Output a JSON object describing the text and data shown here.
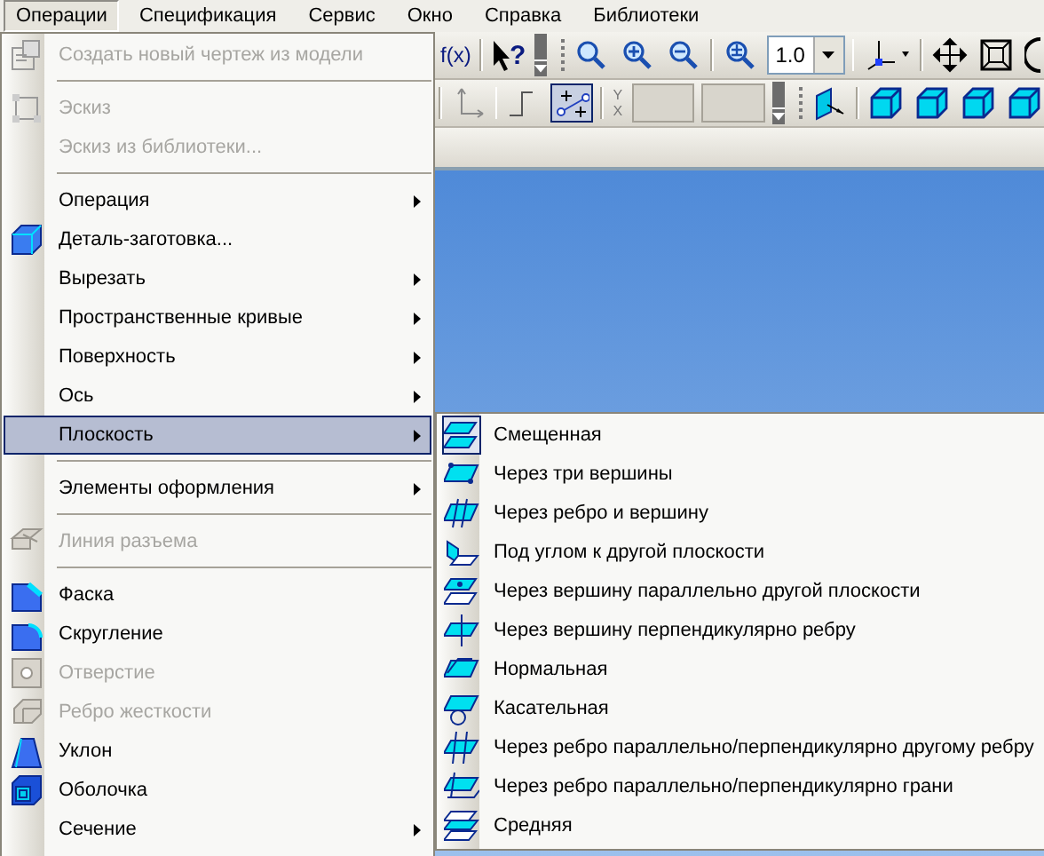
{
  "menubar": [
    {
      "label": "Операции",
      "selected": true
    },
    {
      "label": "Спецификация",
      "selected": false
    },
    {
      "label": "Сервис",
      "selected": false
    },
    {
      "label": "Окно",
      "selected": false
    },
    {
      "label": "Справка",
      "selected": false
    },
    {
      "label": "Библиотеки",
      "selected": false
    }
  ],
  "toolbar_rows": [
    [
      {
        "kind": "text",
        "label": "f(x)"
      },
      {
        "kind": "separator"
      },
      {
        "kind": "help",
        "label": "?"
      },
      {
        "kind": "chevron"
      },
      {
        "kind": "grip"
      },
      {
        "kind": "zoom-window"
      },
      {
        "kind": "zoom-in"
      },
      {
        "kind": "zoom-out"
      },
      {
        "kind": "separator"
      },
      {
        "kind": "zoom-scale"
      },
      {
        "kind": "combo",
        "value": "1.0"
      },
      {
        "kind": "separator"
      },
      {
        "kind": "axes"
      },
      {
        "kind": "separator"
      },
      {
        "kind": "pan"
      },
      {
        "kind": "frame"
      },
      {
        "kind": "rotate"
      }
    ],
    [
      {
        "kind": "separator"
      },
      {
        "kind": "axis-disabled"
      },
      {
        "kind": "separator"
      },
      {
        "kind": "step"
      },
      {
        "kind": "snap",
        "selected": true
      },
      {
        "kind": "separator"
      },
      {
        "kind": "coord",
        "labels": [
          "Y",
          "X"
        ]
      },
      {
        "kind": "blank-field"
      },
      {
        "kind": "blank-field"
      },
      {
        "kind": "chevron"
      },
      {
        "kind": "grip"
      },
      {
        "kind": "plane"
      },
      {
        "kind": "separator"
      },
      {
        "kind": "cube"
      },
      {
        "kind": "cube"
      },
      {
        "kind": "cube"
      },
      {
        "kind": "cube"
      }
    ]
  ],
  "menu": {
    "items": [
      {
        "kind": "command",
        "label": "Создать новый чертеж из модели",
        "disabled": true,
        "selected": false
      },
      {
        "kind": "separator"
      },
      {
        "kind": "command",
        "label": "Эскиз",
        "disabled": true,
        "selected": false
      },
      {
        "kind": "command",
        "label": "Эскиз из библиотеки...",
        "disabled": true,
        "selected": false
      },
      {
        "kind": "separator"
      },
      {
        "kind": "submenu",
        "label": "Операция",
        "disabled": false,
        "selected": false
      },
      {
        "kind": "command",
        "label": "Деталь-заготовка...",
        "disabled": false,
        "selected": false
      },
      {
        "kind": "submenu",
        "label": "Вырезать",
        "disabled": false,
        "selected": false
      },
      {
        "kind": "submenu",
        "label": "Пространственные кривые",
        "disabled": false,
        "selected": false
      },
      {
        "kind": "submenu",
        "label": "Поверхность",
        "disabled": false,
        "selected": false
      },
      {
        "kind": "submenu",
        "label": "Ось",
        "disabled": false,
        "selected": false
      },
      {
        "kind": "submenu",
        "label": "Плоскость",
        "disabled": false,
        "selected": true
      },
      {
        "kind": "separator"
      },
      {
        "kind": "submenu",
        "label": "Элементы оформления",
        "disabled": false,
        "selected": false
      },
      {
        "kind": "separator"
      },
      {
        "kind": "command",
        "label": "Линия разъема",
        "disabled": true,
        "selected": false
      },
      {
        "kind": "separator"
      },
      {
        "kind": "command",
        "label": "Фаска",
        "disabled": false,
        "selected": false
      },
      {
        "kind": "command",
        "label": "Скругление",
        "disabled": false,
        "selected": false
      },
      {
        "kind": "command",
        "label": "Отверстие",
        "disabled": true,
        "selected": false
      },
      {
        "kind": "command",
        "label": "Ребро жесткости",
        "disabled": true,
        "selected": false
      },
      {
        "kind": "command",
        "label": "Уклон",
        "disabled": false,
        "selected": false
      },
      {
        "kind": "command",
        "label": "Оболочка",
        "disabled": false,
        "selected": false
      },
      {
        "kind": "submenu",
        "label": "Сечение",
        "disabled": false,
        "selected": false
      }
    ]
  },
  "submenu": {
    "items": [
      {
        "label": "Смещенная",
        "checked": true
      },
      {
        "label": "Через три вершины",
        "checked": false
      },
      {
        "label": "Через ребро и вершину",
        "checked": false
      },
      {
        "label": "Под углом к другой плоскости",
        "checked": false
      },
      {
        "label": "Через вершину параллельно другой плоскости",
        "checked": false
      },
      {
        "label": "Через вершину перпендикулярно ребру",
        "checked": false
      },
      {
        "label": "Нормальная",
        "checked": false
      },
      {
        "label": "Касательная",
        "checked": false
      },
      {
        "label": "Через ребро параллельно/перпендикулярно другому ребру",
        "checked": false
      },
      {
        "label": "Через ребро параллельно/перпендикулярно грани",
        "checked": false
      },
      {
        "label": "Средняя",
        "checked": false
      }
    ]
  }
}
